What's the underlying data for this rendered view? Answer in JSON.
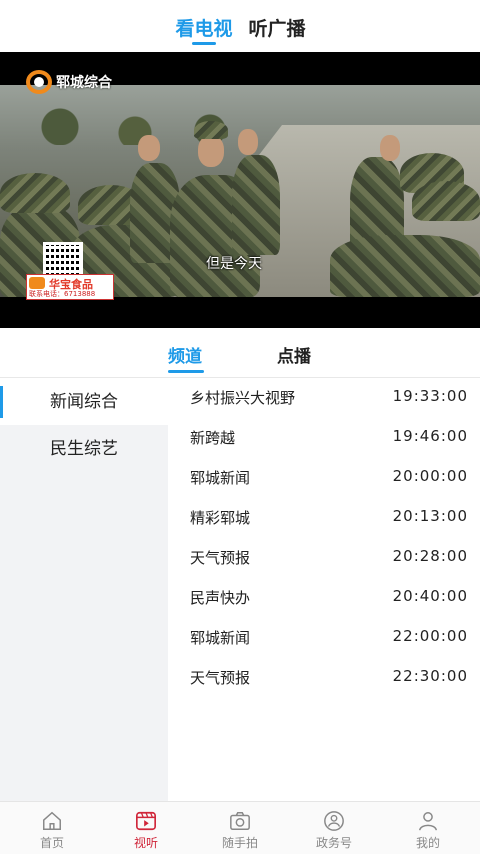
{
  "top_tabs": [
    {
      "label": "看电视",
      "active": true
    },
    {
      "label": "听广播",
      "active": false
    }
  ],
  "player": {
    "channel_logo_text": "郓城综合",
    "subtitle": "但是今天",
    "ad": {
      "title": "华宝食品",
      "phone": "联系电话：6713888"
    }
  },
  "sub_tabs": [
    {
      "label": "频道",
      "active": true
    },
    {
      "label": "点播",
      "active": false
    }
  ],
  "channels": [
    {
      "label": "新闻综合",
      "active": true
    },
    {
      "label": "民生综艺",
      "active": false
    }
  ],
  "programs": [
    {
      "name": "乡村振兴大视野",
      "time": "19:33:00"
    },
    {
      "name": "新跨越",
      "time": "19:46:00"
    },
    {
      "name": "郓城新闻",
      "time": "20:00:00"
    },
    {
      "name": "精彩郓城",
      "time": "20:13:00"
    },
    {
      "name": "天气预报",
      "time": "20:28:00"
    },
    {
      "name": "民声快办",
      "time": "20:40:00"
    },
    {
      "name": "郓城新闻",
      "time": "22:00:00"
    },
    {
      "name": "天气预报",
      "time": "22:30:00"
    }
  ],
  "bottom_nav": [
    {
      "label": "首页",
      "icon": "home-icon",
      "active": false
    },
    {
      "label": "视听",
      "icon": "video-play-icon",
      "active": true
    },
    {
      "label": "随手拍",
      "icon": "camera-icon",
      "active": false
    },
    {
      "label": "政务号",
      "icon": "government-icon",
      "active": false
    },
    {
      "label": "我的",
      "icon": "user-icon",
      "active": false
    }
  ],
  "colors": {
    "accent": "#1e9ae8",
    "nav_active": "#d0263a",
    "sidebar_bg": "#f2f3f5"
  }
}
